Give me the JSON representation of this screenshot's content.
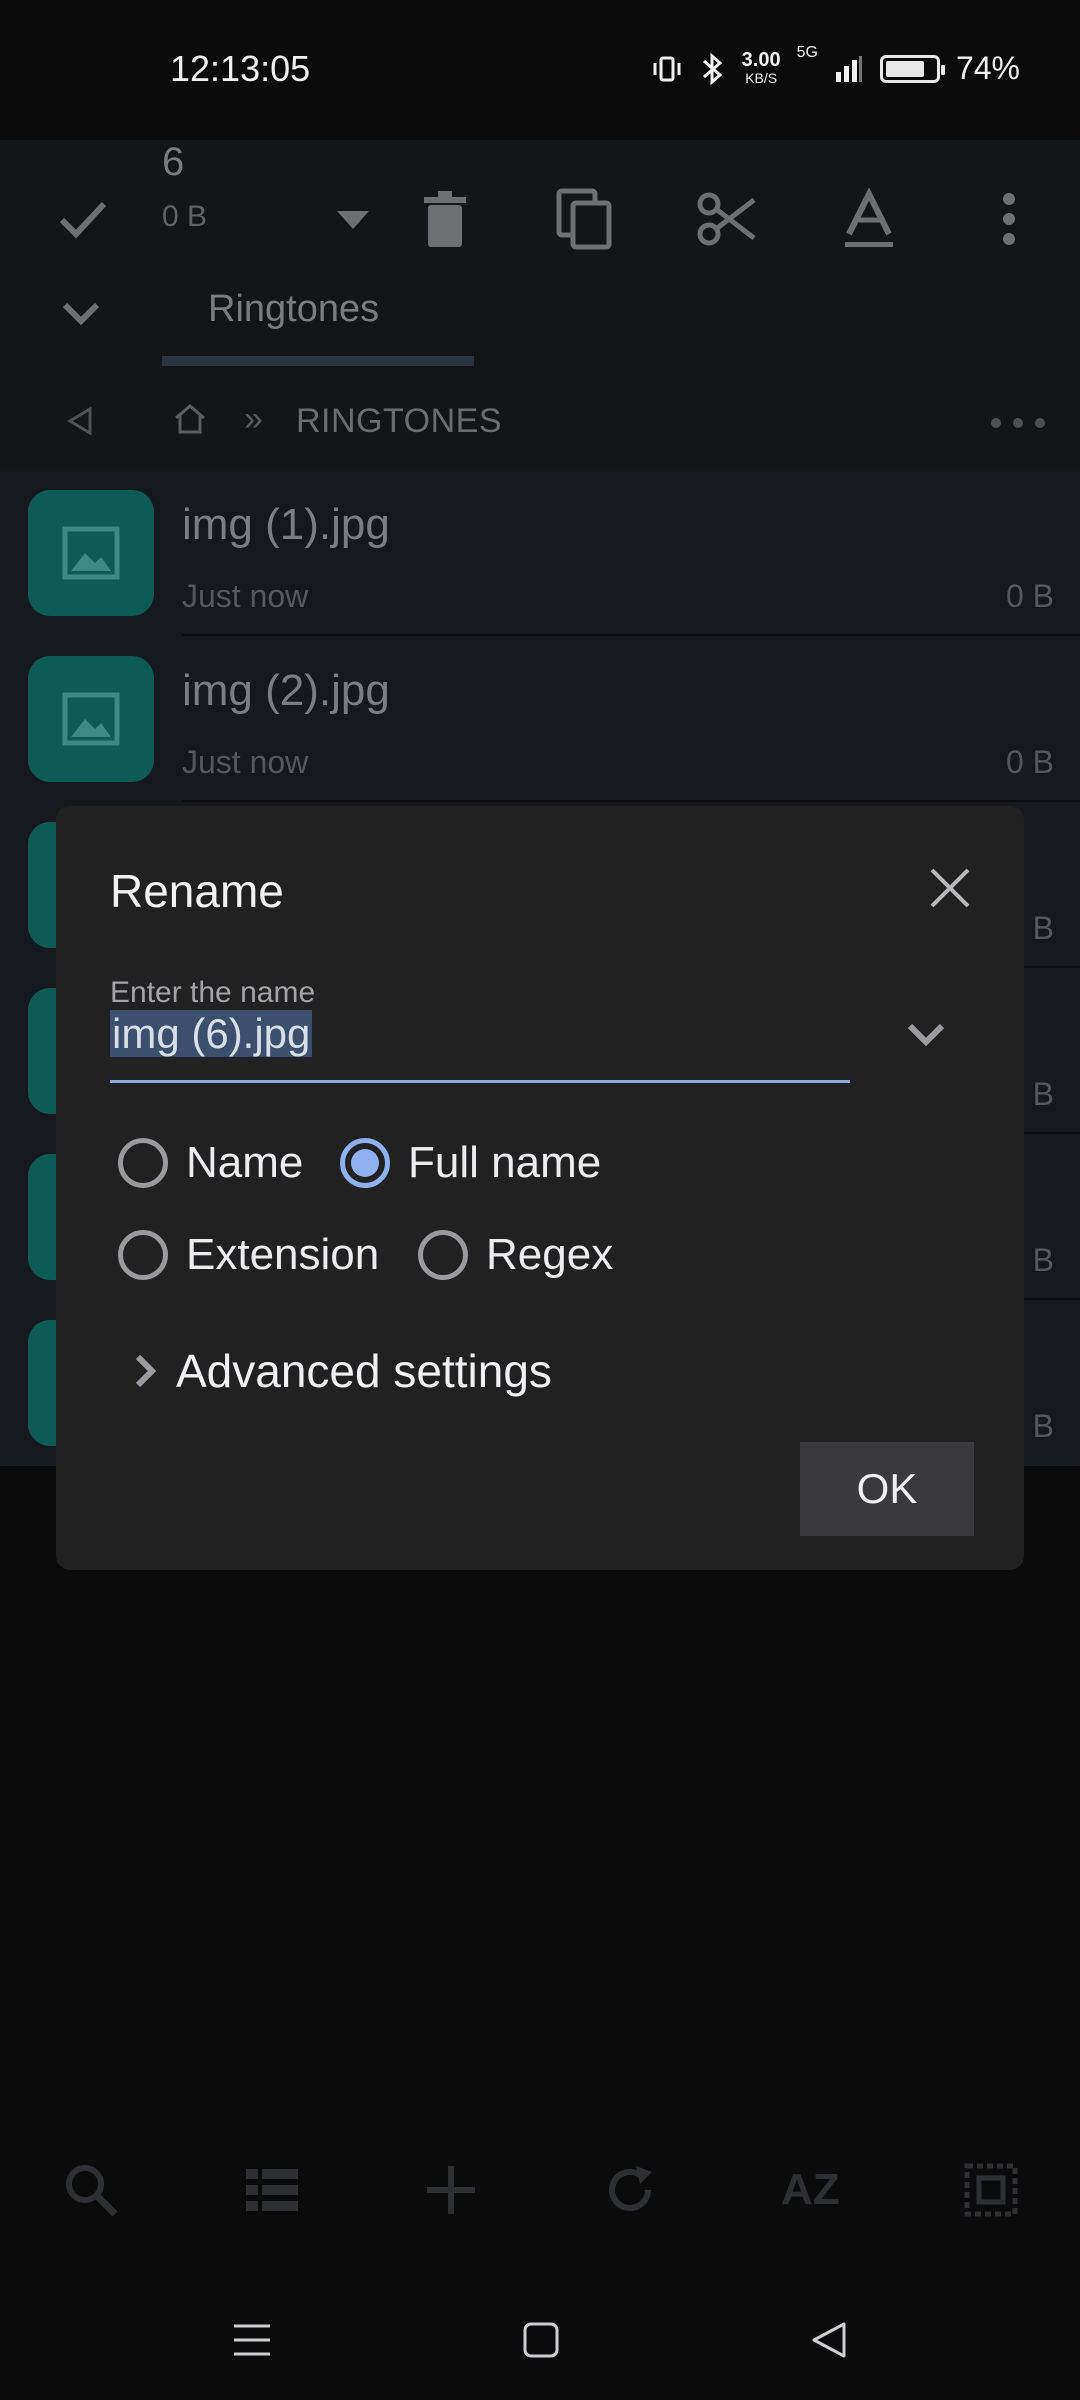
{
  "status_bar": {
    "time": "12:13:05",
    "net_speed_value": "3.00",
    "net_speed_unit": "KB/S",
    "network": "5G",
    "battery": "74%"
  },
  "toolbar": {
    "selected_count": "6",
    "selected_size": "0 B"
  },
  "tab": {
    "label": "Ringtones"
  },
  "breadcrumb": {
    "separator": "»",
    "folder": "RINGTONES"
  },
  "files": [
    {
      "name": "img (1).jpg",
      "date": "Just now",
      "size": "0 B"
    },
    {
      "name": "img (2).jpg",
      "date": "Just now",
      "size": "0 B"
    },
    {
      "name": "",
      "date": "",
      "size": "B"
    },
    {
      "name": "",
      "date": "",
      "size": "B"
    },
    {
      "name": "",
      "date": "",
      "size": "B"
    },
    {
      "name": "",
      "date": "",
      "size": "B"
    }
  ],
  "dialog": {
    "title": "Rename",
    "field_label": "Enter the name",
    "field_value": "img (6).jpg",
    "options": [
      {
        "label": "Name",
        "selected": false
      },
      {
        "label": "Full name",
        "selected": true
      },
      {
        "label": "Extension",
        "selected": false
      },
      {
        "label": "Regex",
        "selected": false
      }
    ],
    "advanced_label": "Advanced settings",
    "ok_label": "OK"
  },
  "bottom_bar": {
    "sort_label": "AZ"
  },
  "colors": {
    "accent": "#8fb1ef",
    "thumb": "#0e5a55",
    "dialog_bg": "#212122"
  }
}
